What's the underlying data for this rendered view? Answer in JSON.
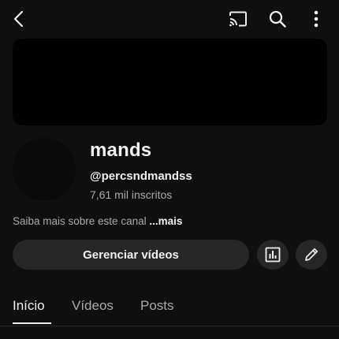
{
  "channel": {
    "name": "mands",
    "handle": "@percsndmandss",
    "subscribers": "7,61 mil inscritos",
    "about_text": "Saiba mais sobre este canal ",
    "about_more": "...mais"
  },
  "actions": {
    "manage_videos_label": "Gerenciar vídeos"
  },
  "tabs": [
    {
      "label": "Início",
      "active": true
    },
    {
      "label": "Vídeos",
      "active": false
    },
    {
      "label": "Posts",
      "active": false
    }
  ],
  "icons": {
    "back": "back-arrow-icon",
    "cast": "cast-icon",
    "search": "search-icon",
    "more": "more-vert-icon",
    "analytics": "analytics-icon",
    "edit": "pencil-icon"
  },
  "colors": {
    "background": "#0f0f0f",
    "surface": "#272727",
    "text_primary": "#f1f1f1",
    "text_secondary": "#aaaaaa"
  }
}
